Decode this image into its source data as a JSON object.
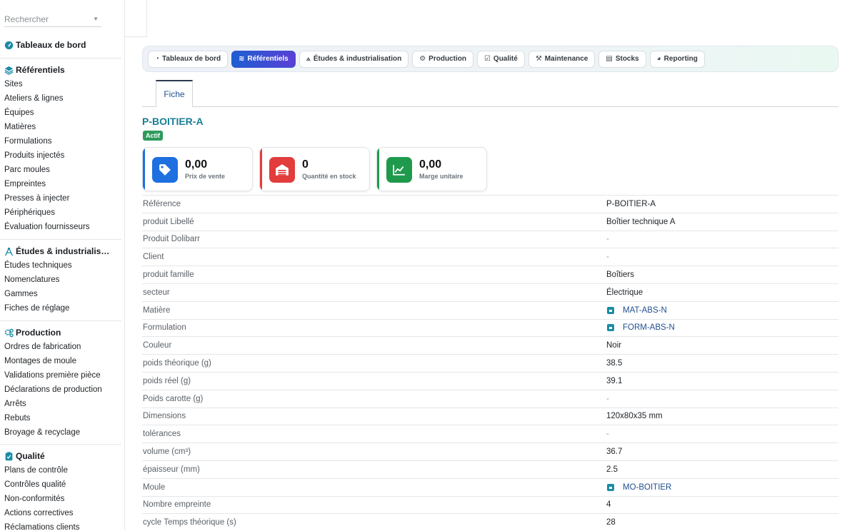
{
  "search": {
    "placeholder": "Rechercher"
  },
  "sidebar": {
    "dashboard": "Tableaux de bord",
    "groups": [
      {
        "title": "Référentiels",
        "icon": "layers-icon",
        "items": [
          "Sites",
          "Ateliers & lignes",
          "Équipes",
          "Matières",
          "Formulations",
          "Produits injectés",
          "Parc moules",
          "Empreintes",
          "Presses à injecter",
          "Périphériques",
          "Évaluation fournisseurs"
        ]
      },
      {
        "title": "Études & industrialis…",
        "icon": "compass-icon",
        "items": [
          "Études techniques",
          "Nomenclatures",
          "Gammes",
          "Fiches de réglage"
        ]
      },
      {
        "title": "Production",
        "icon": "gears-icon",
        "items": [
          "Ordres de fabrication",
          "Montages de moule",
          "Validations première pièce",
          "Déclarations de production",
          "Arrêts",
          "Rebuts",
          "Broyage & recyclage"
        ]
      },
      {
        "title": "Qualité",
        "icon": "clipboard-check-icon",
        "items": [
          "Plans de contrôle",
          "Contrôles qualité",
          "Non-conformités",
          "Actions correctives",
          "Réclamations clients"
        ]
      }
    ]
  },
  "topnav": [
    {
      "label": "Tableaux de bord",
      "icon": "gauge-icon",
      "active": false
    },
    {
      "label": "Référentiels",
      "icon": "layers-icon",
      "active": true
    },
    {
      "label": "Études & industrialisation",
      "icon": "compass-icon",
      "active": false
    },
    {
      "label": "Production",
      "icon": "gears-icon",
      "active": false
    },
    {
      "label": "Qualité",
      "icon": "clipboard-check-icon",
      "active": false
    },
    {
      "label": "Maintenance",
      "icon": "wrench-icon",
      "active": false
    },
    {
      "label": "Stocks",
      "icon": "warehouse-icon",
      "active": false
    },
    {
      "label": "Reporting",
      "icon": "chart-pie-icon",
      "active": false
    }
  ],
  "tabs": {
    "fiche": "Fiche"
  },
  "product": {
    "title": "P-BOITIER-A",
    "status": "Actif"
  },
  "cards": [
    {
      "value": "0,00",
      "label": "Prix de vente",
      "icon": "tag-icon",
      "color": "#1e6fe0"
    },
    {
      "value": "0",
      "label": "Quantité en stock",
      "icon": "warehouse-icon",
      "color": "#e23c3c"
    },
    {
      "value": "0,00",
      "label": "Marge unitaire",
      "icon": "chart-line-icon",
      "color": "#1f9a4c"
    }
  ],
  "fields": [
    {
      "label": "Référence",
      "value": "P-BOITIER-A"
    },
    {
      "label": "produit Libellé",
      "value": "Boîtier technique A"
    },
    {
      "label": "Produit Dolibarr",
      "value": "-"
    },
    {
      "label": "Client",
      "value": "-"
    },
    {
      "label": "produit famille",
      "value": "Boîtiers"
    },
    {
      "label": "secteur",
      "value": "Électrique"
    },
    {
      "label": "Matière",
      "value": "MAT-ABS-N",
      "link": true
    },
    {
      "label": "Formulation",
      "value": "FORM-ABS-N",
      "link": true
    },
    {
      "label": "Couleur",
      "value": "Noir"
    },
    {
      "label": "poids théorique (g)",
      "value": "38.5"
    },
    {
      "label": "poids réel (g)",
      "value": "39.1"
    },
    {
      "label": "Poids carotte (g)",
      "value": "-"
    },
    {
      "label": "Dimensions",
      "value": "120x80x35 mm"
    },
    {
      "label": "tolérances",
      "value": "-"
    },
    {
      "label": "volume (cm³)",
      "value": "36.7"
    },
    {
      "label": "épaisseur (mm)",
      "value": "2.5"
    },
    {
      "label": "Moule",
      "value": "MO-BOITIER",
      "link": true
    },
    {
      "label": "Nombre empreinte",
      "value": "4"
    },
    {
      "label": "cycle Temps théorique (s)",
      "value": "28"
    }
  ]
}
